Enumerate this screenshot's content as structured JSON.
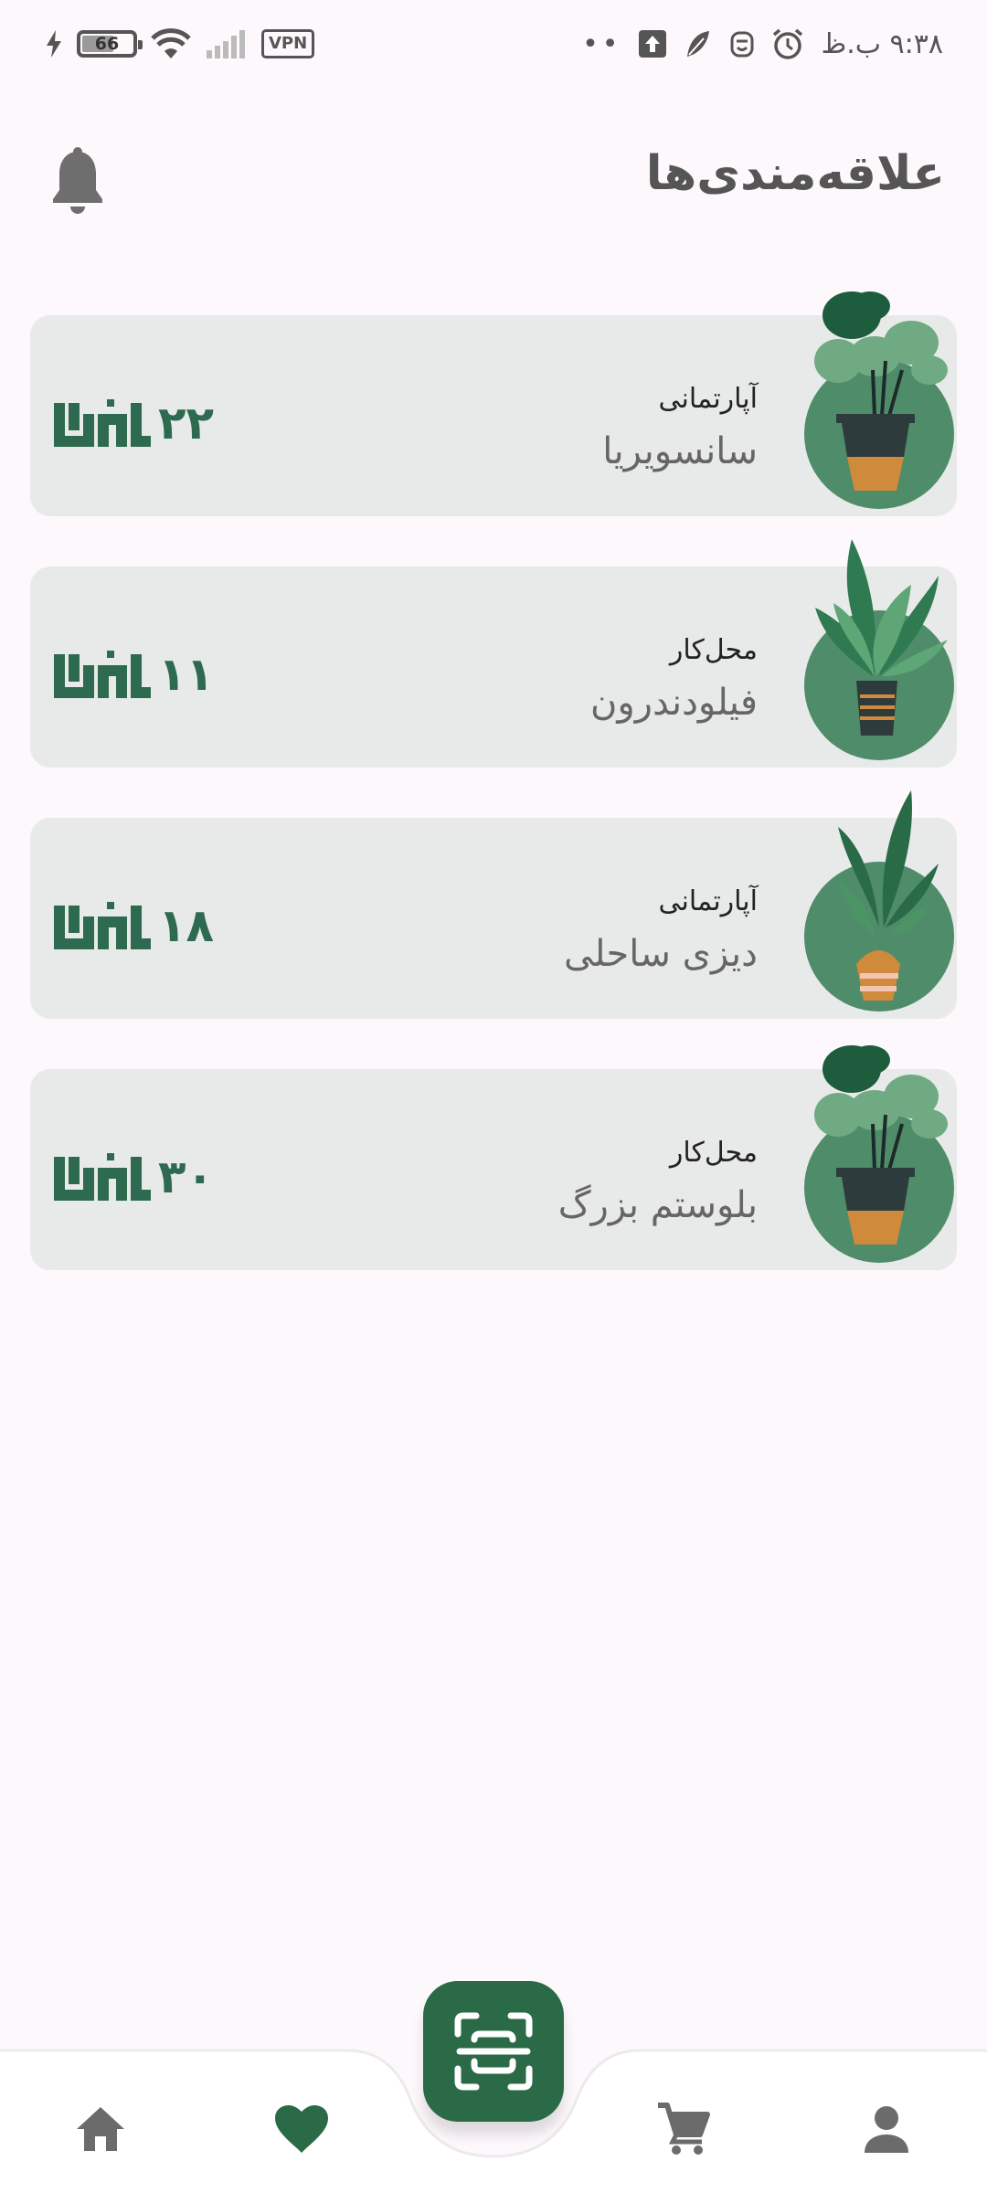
{
  "status_bar": {
    "time": "۹:۳۸ ب.ظ",
    "battery_level": "66",
    "vpn_label": "VPN",
    "dots": "••"
  },
  "header": {
    "title": "علاقه‌مندی‌ها"
  },
  "favorites": [
    {
      "category": "آپارتمانی",
      "name": "سانسویریا",
      "price": "۲۲",
      "currency": "تومان"
    },
    {
      "category": "محل‌کار",
      "name": "فیلودندرون",
      "price": "۱۱",
      "currency": "تومان"
    },
    {
      "category": "آپارتمانی",
      "name": "دیزی ساحلی",
      "price": "۱۸",
      "currency": "تومان"
    },
    {
      "category": "محل‌کار",
      "name": "بلوستم بزرگ",
      "price": "۳۰",
      "currency": "تومان"
    }
  ],
  "bottom_nav": {
    "items": [
      "home-icon",
      "heart-icon",
      "scan-icon",
      "cart-icon",
      "person-icon"
    ],
    "active": "heart-icon"
  },
  "colors": {
    "brand_green": "#2B6A47",
    "price_green": "#2D6A4F",
    "card_bg": "#E8EAE9",
    "page_bg": "#FDF8FC",
    "plant_circle": "#4E8C6A"
  }
}
